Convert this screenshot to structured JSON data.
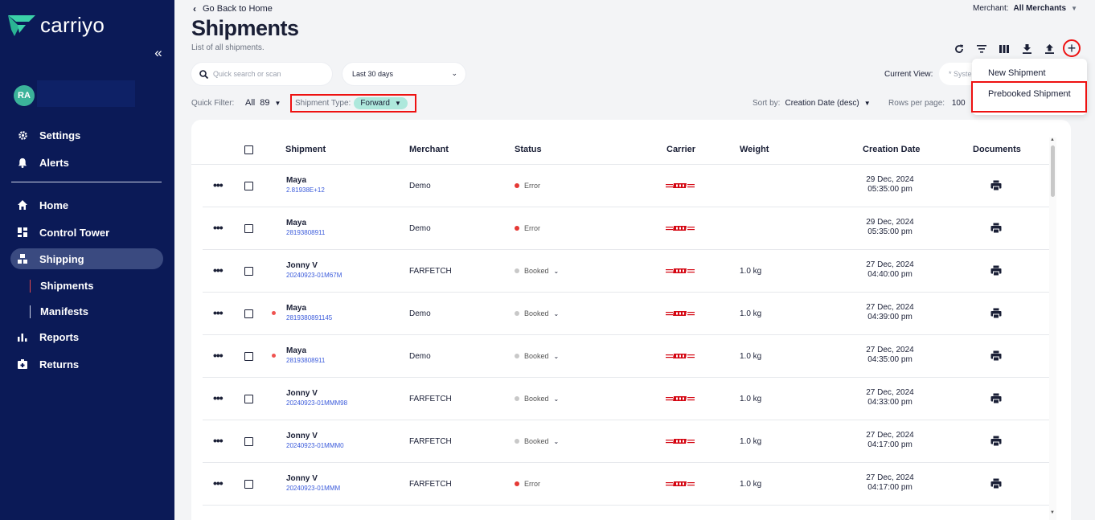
{
  "sidebar": {
    "brand": "carriyo",
    "avatar_initials": "RA",
    "top_items": [
      {
        "label": "Settings",
        "icon": "gear-icon"
      },
      {
        "label": "Alerts",
        "icon": "bell-icon"
      }
    ],
    "items": [
      {
        "label": "Home",
        "icon": "home-icon"
      },
      {
        "label": "Control Tower",
        "icon": "dashboard-icon"
      },
      {
        "label": "Shipping",
        "icon": "shipping-icon"
      },
      {
        "label": "Reports",
        "icon": "bar-chart-icon"
      },
      {
        "label": "Returns",
        "icon": "returns-icon"
      }
    ],
    "sub_items": [
      {
        "label": "Shipments"
      },
      {
        "label": "Manifests"
      }
    ]
  },
  "header": {
    "back_label": "Go Back to Home",
    "title": "Shipments",
    "subtitle": "List of all shipments.",
    "merchant_label": "Merchant:",
    "merchant_value": "All Merchants"
  },
  "filters": {
    "search_placeholder": "Quick search or scan",
    "date_range": "Last 30 days",
    "current_view_label": "Current View:",
    "current_view_value": "* Syste",
    "quick_filter_label": "Quick Filter:",
    "quick_filter_value": "All",
    "quick_filter_count": "89",
    "shipment_type_label": "Shipment Type:",
    "shipment_type_value": "Forward",
    "sort_label": "Sort by:",
    "sort_value": "Creation Date (desc)",
    "rows_label": "Rows per page:",
    "rows_value": "100"
  },
  "menu": {
    "new_shipment": "New Shipment",
    "prebooked_shipment": "Prebooked Shipment"
  },
  "table": {
    "headers": {
      "shipment": "Shipment",
      "merchant": "Merchant",
      "status": "Status",
      "carrier": "Carrier",
      "weight": "Weight",
      "creation_date": "Creation Date",
      "documents": "Documents"
    },
    "rows": [
      {
        "customer": "Maya",
        "ref": "2.81938E+12",
        "merchant": "Demo",
        "status": "Error",
        "status_color": "#e53935",
        "has_dropdown": false,
        "weight": "",
        "date": "29 Dec, 2024",
        "time": "05:35:00 pm",
        "unread": false
      },
      {
        "customer": "Maya",
        "ref": "28193808911",
        "merchant": "Demo",
        "status": "Error",
        "status_color": "#e53935",
        "has_dropdown": false,
        "weight": "",
        "date": "29 Dec, 2024",
        "time": "05:35:00 pm",
        "unread": false
      },
      {
        "customer": "Jonny V",
        "ref": "20240923-01M67M",
        "merchant": "FARFETCH",
        "status": "Booked",
        "status_color": "#c8c8c8",
        "has_dropdown": true,
        "weight": "1.0 kg",
        "date": "27 Dec, 2024",
        "time": "04:40:00 pm",
        "unread": false
      },
      {
        "customer": "Maya",
        "ref": "2819380891145",
        "merchant": "Demo",
        "status": "Booked",
        "status_color": "#c8c8c8",
        "has_dropdown": true,
        "weight": "1.0 kg",
        "date": "27 Dec, 2024",
        "time": "04:39:00 pm",
        "unread": true
      },
      {
        "customer": "Maya",
        "ref": "28193808911",
        "merchant": "Demo",
        "status": "Booked",
        "status_color": "#c8c8c8",
        "has_dropdown": true,
        "weight": "1.0 kg",
        "date": "27 Dec, 2024",
        "time": "04:35:00 pm",
        "unread": true
      },
      {
        "customer": "Jonny V",
        "ref": "20240923-01MMM98",
        "merchant": "FARFETCH",
        "status": "Booked",
        "status_color": "#c8c8c8",
        "has_dropdown": true,
        "weight": "1.0 kg",
        "date": "27 Dec, 2024",
        "time": "04:33:00 pm",
        "unread": false
      },
      {
        "customer": "Jonny V",
        "ref": "20240923-01MMM0",
        "merchant": "FARFETCH",
        "status": "Booked",
        "status_color": "#c8c8c8",
        "has_dropdown": true,
        "weight": "1.0 kg",
        "date": "27 Dec, 2024",
        "time": "04:17:00 pm",
        "unread": false
      },
      {
        "customer": "Jonny V",
        "ref": "20240923-01MMM",
        "merchant": "FARFETCH",
        "status": "Error",
        "status_color": "#e53935",
        "has_dropdown": false,
        "weight": "1.0 kg",
        "date": "27 Dec, 2024",
        "time": "04:17:00 pm",
        "unread": false
      }
    ]
  },
  "colors": {
    "sidebar_bg": "#0b1a57",
    "accent_teal": "#3bb39a",
    "chip_bg": "#aee8dc",
    "highlight_red": "#e11111",
    "dhl_red": "#d40511"
  }
}
